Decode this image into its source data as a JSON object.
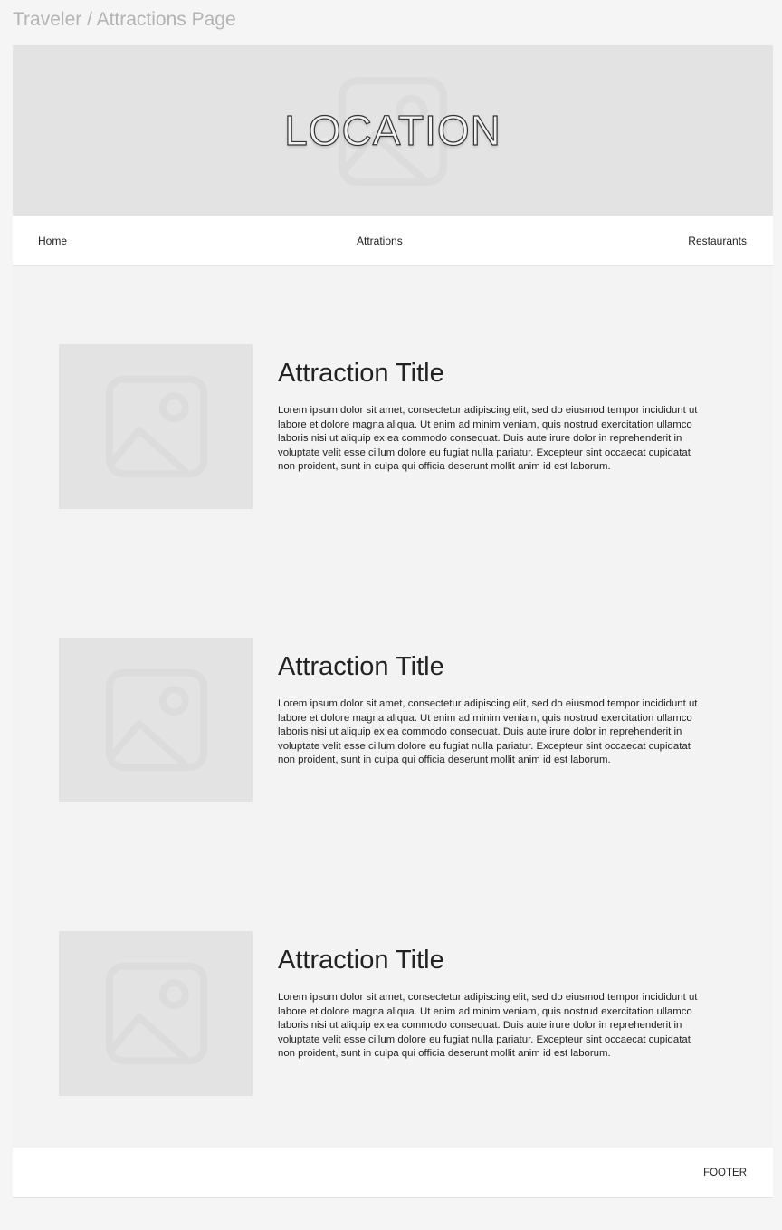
{
  "frame": {
    "title": "Traveler / Attractions Page"
  },
  "hero": {
    "title": "LOCATION",
    "icon": "image-placeholder-icon"
  },
  "nav": {
    "items": [
      {
        "label": "Home"
      },
      {
        "label": "Attrations"
      },
      {
        "label": "Restaurants"
      }
    ]
  },
  "attractions": [
    {
      "title": "Attraction Title",
      "description": "Lorem ipsum dolor sit amet, consectetur adipiscing elit, sed do eiusmod tempor incididunt ut labore et dolore magna aliqua. Ut enim ad minim veniam, quis nostrud exercitation ullamco laboris nisi ut aliquip ex ea commodo consequat. Duis aute irure dolor in reprehenderit in voluptate velit esse cillum dolore eu fugiat nulla pariatur. Excepteur sint occaecat cupidatat non proident, sunt in culpa qui officia deserunt mollit anim id est laborum.",
      "image_icon": "image-placeholder-icon"
    },
    {
      "title": "Attraction Title",
      "description": "Lorem ipsum dolor sit amet, consectetur adipiscing elit, sed do eiusmod tempor incididunt ut labore et dolore magna aliqua. Ut enim ad minim veniam, quis nostrud exercitation ullamco laboris nisi ut aliquip ex ea commodo consequat. Duis aute irure dolor in reprehenderit in voluptate velit esse cillum dolore eu fugiat nulla pariatur. Excepteur sint occaecat cupidatat non proident, sunt in culpa qui officia deserunt mollit anim id est laborum.",
      "image_icon": "image-placeholder-icon"
    },
    {
      "title": "Attraction Title",
      "description": "Lorem ipsum dolor sit amet, consectetur adipiscing elit, sed do eiusmod tempor incididunt ut labore et dolore magna aliqua. Ut enim ad minim veniam, quis nostrud exercitation ullamco laboris nisi ut aliquip ex ea commodo consequat. Duis aute irure dolor in reprehenderit in voluptate velit esse cillum dolore eu fugiat nulla pariatur. Excepteur sint occaecat cupidatat non proident, sunt in culpa qui officia deserunt mollit anim id est laborum.",
      "image_icon": "image-placeholder-icon"
    }
  ],
  "footer": {
    "label": "FOOTER"
  },
  "colors": {
    "page_background": "#f5f5f5",
    "content_background": "#f3f3f3",
    "placeholder": "#e3e3e3",
    "placeholder_icon": "#dcdcdc",
    "bar_background": "#ffffff",
    "text": "#222222",
    "frame_title": "#b3b3b3"
  }
}
